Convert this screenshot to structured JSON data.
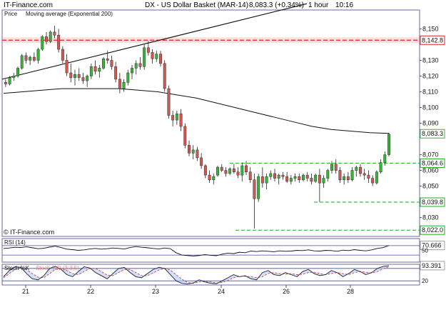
{
  "header": {
    "brand": "IT-Finance.com",
    "title": "DX - US Dollar Basket (MAR-14)",
    "quote": "8,083.3 (+0.34%)",
    "timeframe": "1 hour",
    "time": "10:16"
  },
  "colors": {
    "up": "#39b339",
    "down": "#d9534f",
    "wick": "#222222",
    "ema": "#111111",
    "trendline": "#111111",
    "resistance": "#e02020",
    "support": "#22aa22",
    "panel_border": "#6a6aa0",
    "rsi_line": "#111111",
    "stoch_k": "#222222",
    "stoch_d": "#d04040",
    "stoch_fill": "#b8c8ff"
  },
  "chart_data": [
    {
      "type": "candlestick",
      "legend": [
        "Price",
        "Moving average (Exponential 200)"
      ],
      "copyright": "© IT-Finance.com",
      "x_tick_labels": [
        "21",
        "22",
        "23",
        "24",
        "26",
        "28"
      ],
      "y_tick_labels": [
        "8,150",
        "8,140",
        "8,130",
        "8,120",
        "8,110",
        "8,100",
        "8,090",
        "8,080",
        "8,070",
        "8,060",
        "8,050",
        "8,040",
        "8,030"
      ],
      "ylim": [
        8018,
        8162
      ],
      "y_labels": [
        8150,
        8130,
        8120,
        8110,
        8100,
        8090,
        8070,
        8060,
        8050,
        8030
      ],
      "price_tags": [
        {
          "value": 8142.8,
          "label": "8,142.8",
          "color": "#e02020"
        },
        {
          "value": 8083.3,
          "label": "8,083.3",
          "color": "#39b339"
        },
        {
          "value": 8064.6,
          "label": "8,064.6",
          "color": "#22aa22"
        },
        {
          "value": 8039.8,
          "label": "8,039.8",
          "color": "#22aa22"
        },
        {
          "value": 8022.0,
          "label": "8,022.0",
          "color": "#22aa22"
        }
      ],
      "horizontal_lines": [
        {
          "value": 8142.8,
          "kind": "resistance"
        },
        {
          "value": 8064.6,
          "kind": "support"
        },
        {
          "value": 8039.8,
          "kind": "support"
        },
        {
          "value": 8022.0,
          "kind": "support"
        }
      ],
      "candles": [
        [
          8116,
          8118,
          8113,
          8115
        ],
        [
          8115,
          8120,
          8114,
          8119
        ],
        [
          8119,
          8122,
          8117,
          8120
        ],
        [
          8120,
          8126,
          8119,
          8125
        ],
        [
          8125,
          8134,
          8124,
          8133
        ],
        [
          8133,
          8135,
          8128,
          8130
        ],
        [
          8130,
          8133,
          8127,
          8132
        ],
        [
          8132,
          8135,
          8129,
          8130
        ],
        [
          8130,
          8138,
          8128,
          8137
        ],
        [
          8137,
          8146,
          8136,
          8145
        ],
        [
          8145,
          8148,
          8140,
          8142
        ],
        [
          8142,
          8149,
          8141,
          8148
        ],
        [
          8148,
          8152,
          8144,
          8146
        ],
        [
          8146,
          8150,
          8135,
          8137
        ],
        [
          8137,
          8139,
          8128,
          8130
        ],
        [
          8130,
          8134,
          8120,
          8122
        ],
        [
          8122,
          8128,
          8116,
          8119
        ],
        [
          8119,
          8124,
          8114,
          8121
        ],
        [
          8121,
          8125,
          8117,
          8119
        ],
        [
          8119,
          8122,
          8115,
          8117
        ],
        [
          8117,
          8121,
          8113,
          8120
        ],
        [
          8120,
          8128,
          8118,
          8126
        ],
        [
          8126,
          8130,
          8121,
          8123
        ],
        [
          8123,
          8127,
          8119,
          8125
        ],
        [
          8125,
          8132,
          8124,
          8131
        ],
        [
          8131,
          8136,
          8128,
          8130
        ],
        [
          8130,
          8133,
          8124,
          8126
        ],
        [
          8126,
          8129,
          8116,
          8118
        ],
        [
          8118,
          8122,
          8109,
          8112
        ],
        [
          8112,
          8118,
          8110,
          8116
        ],
        [
          8116,
          8124,
          8114,
          8122
        ],
        [
          8122,
          8127,
          8118,
          8125
        ],
        [
          8125,
          8130,
          8121,
          8128
        ],
        [
          8128,
          8132,
          8124,
          8126
        ],
        [
          8126,
          8140,
          8124,
          8138
        ],
        [
          8138,
          8142,
          8133,
          8135
        ],
        [
          8135,
          8137,
          8128,
          8131
        ],
        [
          8131,
          8136,
          8129,
          8134
        ],
        [
          8134,
          8136,
          8126,
          8128
        ],
        [
          8128,
          8130,
          8110,
          8112
        ],
        [
          8112,
          8114,
          8093,
          8095
        ],
        [
          8095,
          8098,
          8088,
          8092
        ],
        [
          8092,
          8098,
          8089,
          8096
        ],
        [
          8096,
          8099,
          8085,
          8088
        ],
        [
          8088,
          8090,
          8074,
          8076
        ],
        [
          8076,
          8079,
          8069,
          8071
        ],
        [
          8071,
          8076,
          8067,
          8073
        ],
        [
          8073,
          8075,
          8066,
          8068
        ],
        [
          8068,
          8071,
          8061,
          8063
        ],
        [
          8063,
          8064,
          8055,
          8057
        ],
        [
          8057,
          8060,
          8052,
          8054
        ],
        [
          8054,
          8058,
          8051,
          8056
        ],
        [
          8057,
          8063,
          8056,
          8062
        ],
        [
          8062,
          8064,
          8059,
          8060
        ],
        [
          8060,
          8062,
          8056,
          8058
        ],
        [
          8058,
          8062,
          8057,
          8061
        ],
        [
          8061,
          8064,
          8058,
          8059
        ],
        [
          8059,
          8062,
          8055,
          8057
        ],
        [
          8057,
          8065,
          8053,
          8063
        ],
        [
          8063,
          8066,
          8057,
          8059
        ],
        [
          8059,
          8062,
          8052,
          8054
        ],
        [
          8054,
          8058,
          8023,
          8042
        ],
        [
          8042,
          8058,
          8040,
          8056
        ],
        [
          8056,
          8062,
          8049,
          8052
        ],
        [
          8052,
          8058,
          8048,
          8056
        ],
        [
          8056,
          8060,
          8054,
          8058
        ],
        [
          8058,
          8061,
          8053,
          8055
        ],
        [
          8055,
          8058,
          8051,
          8057
        ],
        [
          8057,
          8059,
          8054,
          8056
        ],
        [
          8056,
          8059,
          8052,
          8053
        ],
        [
          8053,
          8057,
          8051,
          8055
        ],
        [
          8055,
          8058,
          8053,
          8056
        ],
        [
          8056,
          8058,
          8052,
          8054
        ],
        [
          8054,
          8058,
          8053,
          8057
        ],
        [
          8057,
          8059,
          8053,
          8055
        ],
        [
          8055,
          8058,
          8051,
          8053
        ],
        [
          8053,
          8058,
          8052,
          8057
        ],
        [
          8057,
          8061,
          8040,
          8052
        ],
        [
          8052,
          8057,
          8049,
          8055
        ],
        [
          8055,
          8061,
          8053,
          8060
        ],
        [
          8060,
          8066,
          8058,
          8064
        ],
        [
          8064,
          8067,
          8058,
          8060
        ],
        [
          8060,
          8062,
          8052,
          8054
        ],
        [
          8054,
          8058,
          8051,
          8056
        ],
        [
          8056,
          8059,
          8052,
          8054
        ],
        [
          8054,
          8062,
          8053,
          8060
        ],
        [
          8060,
          8063,
          8056,
          8062
        ],
        [
          8062,
          8064,
          8056,
          8058
        ],
        [
          8058,
          8061,
          8054,
          8057
        ],
        [
          8057,
          8060,
          8052,
          8055
        ],
        [
          8055,
          8057,
          8050,
          8052
        ],
        [
          8052,
          8060,
          8051,
          8059
        ],
        [
          8059,
          8067,
          8058,
          8065
        ],
        [
          8065,
          8072,
          8063,
          8070
        ],
        [
          8070,
          8084,
          8069,
          8083
        ]
      ],
      "ema": [
        8109,
        8110,
        8111,
        8112,
        8112,
        8112,
        8112,
        8111,
        8110,
        8108,
        8106,
        8103,
        8100,
        8097,
        8094,
        8091,
        8088,
        8086,
        8085,
        8084,
        8083.5
      ],
      "trendline": {
        "start": 8118,
        "end": 8185
      }
    },
    {
      "type": "line",
      "name": "RSI (14)",
      "label": "RSI (14)",
      "ylim": [
        0,
        100
      ],
      "levels": [
        70,
        30
      ],
      "value_label": "70.666",
      "mid_label": "50",
      "values": [
        58,
        60,
        63,
        62,
        65,
        61,
        57,
        59,
        64,
        68,
        62,
        55,
        53,
        50,
        52,
        56,
        58,
        55,
        57,
        60,
        58,
        56,
        62,
        66,
        63,
        61,
        58,
        56,
        60,
        57,
        40,
        30,
        28,
        26,
        28,
        32,
        29,
        27,
        34,
        38,
        36,
        42,
        40,
        47,
        45,
        48,
        46,
        44,
        48,
        46,
        47,
        50,
        49,
        52,
        48,
        47,
        50,
        49,
        46,
        51,
        49,
        53,
        50,
        48,
        52,
        58,
        62,
        70.666
      ]
    },
    {
      "type": "line",
      "name": "Stoch %K",
      "label": "Stoch %K",
      "ghost_label": "Stoch %D (3,3,5)",
      "ylim": [
        0,
        100
      ],
      "levels": [
        80,
        20
      ],
      "value_label": "93.391",
      "low_label": "20",
      "k": [
        40,
        70,
        88,
        85,
        55,
        30,
        25,
        45,
        80,
        90,
        75,
        50,
        40,
        65,
        88,
        82,
        60,
        45,
        30,
        55,
        80,
        85,
        60,
        40,
        35,
        55,
        75,
        85,
        80,
        50,
        20,
        8,
        5,
        10,
        25,
        15,
        8,
        6,
        20,
        35,
        50,
        40,
        45,
        30,
        25,
        60,
        70,
        50,
        45,
        60,
        50,
        40,
        65,
        75,
        55,
        45,
        50,
        70,
        60,
        40,
        55,
        75,
        65,
        50,
        60,
        80,
        90,
        93.391
      ],
      "d": [
        35,
        55,
        75,
        85,
        75,
        55,
        38,
        35,
        55,
        75,
        80,
        70,
        55,
        50,
        65,
        80,
        80,
        65,
        48,
        45,
        60,
        75,
        75,
        60,
        45,
        45,
        58,
        72,
        80,
        72,
        50,
        28,
        12,
        8,
        15,
        18,
        15,
        10,
        12,
        22,
        35,
        42,
        42,
        40,
        35,
        40,
        55,
        60,
        55,
        52,
        55,
        50,
        52,
        60,
        62,
        55,
        50,
        55,
        60,
        55,
        50,
        60,
        65,
        62,
        58,
        65,
        78,
        88
      ]
    }
  ]
}
